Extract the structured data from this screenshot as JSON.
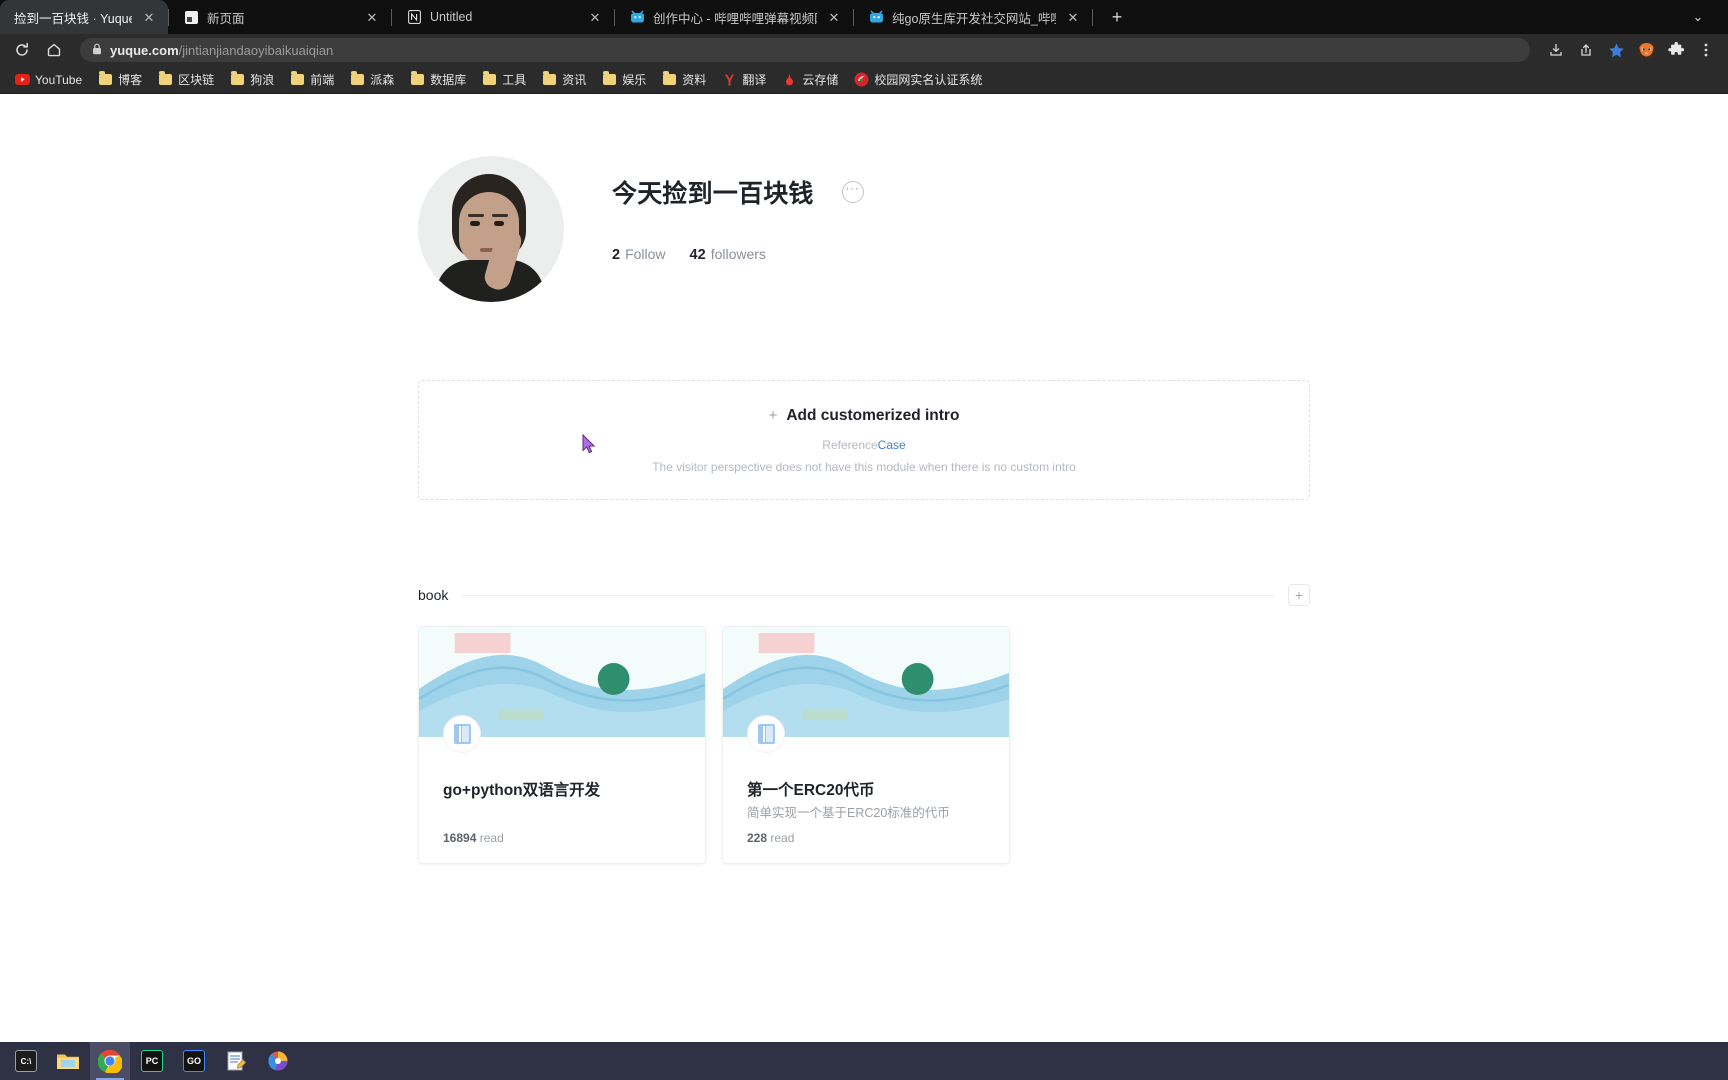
{
  "browser": {
    "tabs": [
      {
        "title": "捡到一百块钱 · Yuque",
        "icon": "none",
        "active": true,
        "closable": true
      },
      {
        "title": "新页面",
        "icon": "page-icon",
        "active": false,
        "closable": true
      },
      {
        "title": "Untitled",
        "icon": "notion-icon",
        "active": false,
        "closable": true
      },
      {
        "title": "创作中心 - 哔哩哔哩弹幕视频网",
        "icon": "bilibili-icon",
        "active": false,
        "closable": true
      },
      {
        "title": "纯go原生库开发社交网站_哔哩",
        "icon": "bilibili-icon",
        "active": false,
        "closable": true
      }
    ],
    "new_tab_label": "+",
    "window_controls": "⌄",
    "toolbar": {
      "reload_label": "↻",
      "home_label": "⌂",
      "url_domain": "yuque.com",
      "url_path": "/jintianjiandaoyibaikuaiqian",
      "lock_label": "🔒",
      "right_icons": [
        "download-icon",
        "share-icon",
        "bookmark-star-icon",
        "profile-avatar-icon",
        "extensions-icon",
        "menu-icon"
      ]
    },
    "bookmarks": [
      {
        "label": "YouTube",
        "icon": "youtube-icon"
      },
      {
        "label": "博客",
        "icon": "folder-icon"
      },
      {
        "label": "区块链",
        "icon": "folder-icon"
      },
      {
        "label": "狗浪",
        "icon": "folder-icon"
      },
      {
        "label": "前端",
        "icon": "folder-icon"
      },
      {
        "label": "派森",
        "icon": "folder-icon"
      },
      {
        "label": "数据库",
        "icon": "folder-icon"
      },
      {
        "label": "工具",
        "icon": "folder-icon"
      },
      {
        "label": "资讯",
        "icon": "folder-icon"
      },
      {
        "label": "娱乐",
        "icon": "folder-icon"
      },
      {
        "label": "资料",
        "icon": "folder-icon"
      },
      {
        "label": "翻译",
        "icon": "youdao-icon"
      },
      {
        "label": "云存储",
        "icon": "flame-icon"
      },
      {
        "label": "校园网实名认证系统",
        "icon": "campus-icon"
      }
    ]
  },
  "profile": {
    "avatar_name": "user-avatar",
    "display_name": "今天捡到一百块钱",
    "more_label": "···",
    "stats": [
      {
        "count": "2",
        "label": "Follow"
      },
      {
        "count": "42",
        "label": "followers"
      }
    ]
  },
  "intro": {
    "add_label": "Add customerized intro",
    "plus": "+",
    "reference_prefix": "Reference",
    "reference_link": "Case",
    "visitor_note": "The visitor perspective does not have this module when there is no custom intro"
  },
  "book_section": {
    "title": "book",
    "add_label": "+",
    "books": [
      {
        "title": "go+python双语言开发",
        "desc": "",
        "reads": "16894",
        "reads_suffix": "read",
        "icon": "book-icon"
      },
      {
        "title": "第一个ERC20代币",
        "desc": "简单实现一个基于ERC20标准的代币",
        "reads": "228",
        "reads_suffix": "read",
        "icon": "book-icon"
      }
    ]
  },
  "taskbar": {
    "items": [
      {
        "name": "cmd-icon",
        "label": "C:\\"
      },
      {
        "name": "file-explorer-icon",
        "label": ""
      },
      {
        "name": "chrome-icon",
        "label": "",
        "active": true
      },
      {
        "name": "pycharm-icon",
        "label": "PC"
      },
      {
        "name": "goland-icon",
        "label": "GO"
      },
      {
        "name": "notepad-icon",
        "label": ""
      },
      {
        "name": "media-icon",
        "label": ""
      }
    ]
  },
  "colors": {
    "accent": "#3f7ecb",
    "text": "#1f2329",
    "muted": "#9aa0a6",
    "chrome_dark": "#2b2b2b"
  }
}
